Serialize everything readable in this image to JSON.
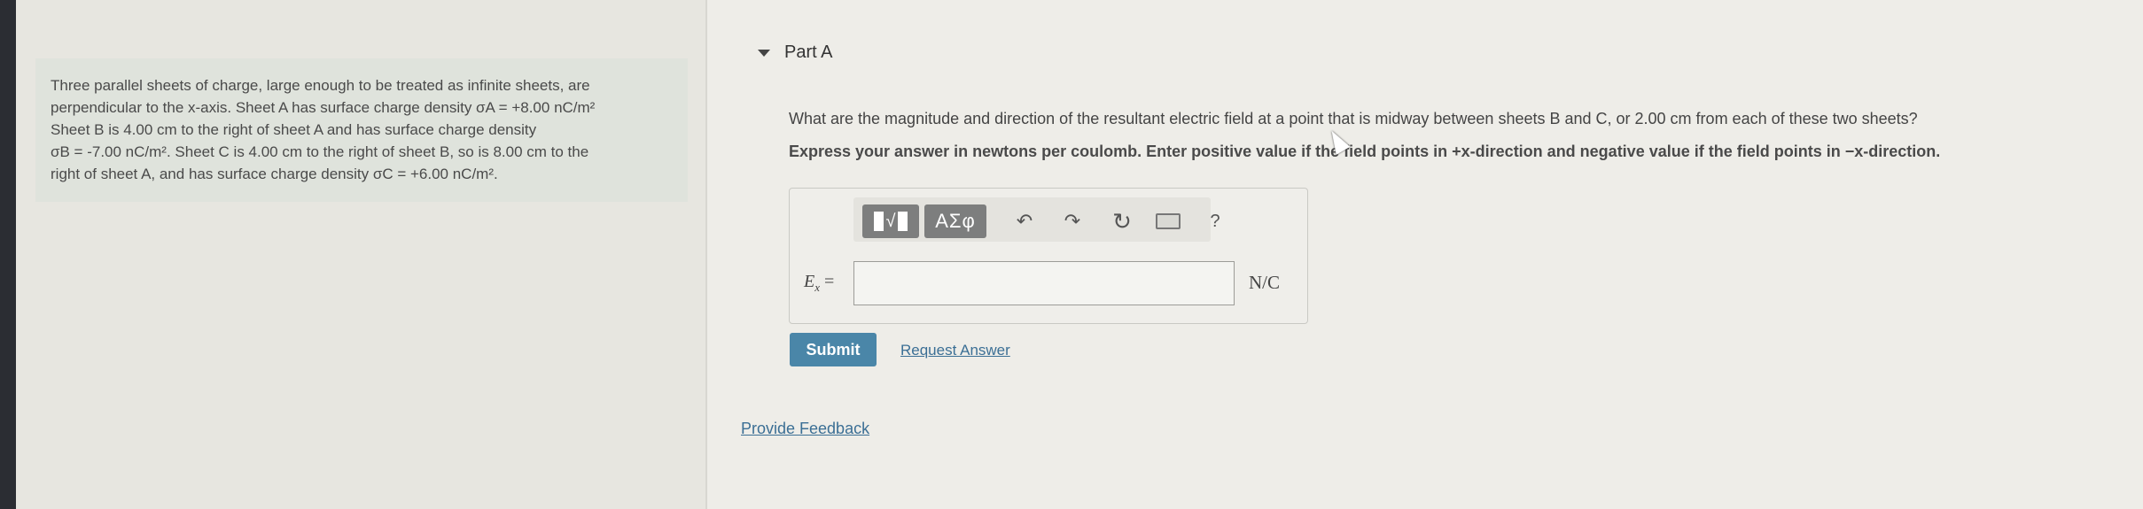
{
  "problem": {
    "lines": [
      "Three parallel sheets of charge, large enough to be treated as infinite sheets, are",
      "perpendicular to the x-axis. Sheet A has surface charge density σA = +8.00 nC/m²",
      "Sheet B is 4.00 cm to the right of sheet A and has surface charge density",
      "σB = -7.00 nC/m². Sheet C is 4.00 cm to the right of sheet B, so is 8.00 cm to the",
      "right of sheet A, and has surface charge density σC = +6.00 nC/m²."
    ]
  },
  "part": {
    "title": "Part A",
    "question": "What are the magnitude and direction of the resultant electric field at a point that is midway between sheets B and C, or 2.00 cm from each of these two sheets?",
    "instruction": "Express your answer in newtons per coulomb. Enter positive value if the field points in +x-direction and negative value if the field points in −x-direction."
  },
  "toolbar": {
    "templates_label": "√",
    "greek_label": "ΑΣφ",
    "undo_icon": "↶",
    "redo_icon": "↷",
    "reset_icon": "↻",
    "help_label": "?"
  },
  "answer": {
    "label": "E",
    "label_sub": "x",
    "label_suffix": " =",
    "value": "",
    "unit": "N/C"
  },
  "actions": {
    "submit_label": "Submit",
    "request_label": "Request Answer",
    "feedback_label": "Provide Feedback"
  },
  "colors": {
    "submit_bg": "#4a86a8",
    "link": "#3b6f95",
    "toolbar_button": "#7d7e7e"
  }
}
